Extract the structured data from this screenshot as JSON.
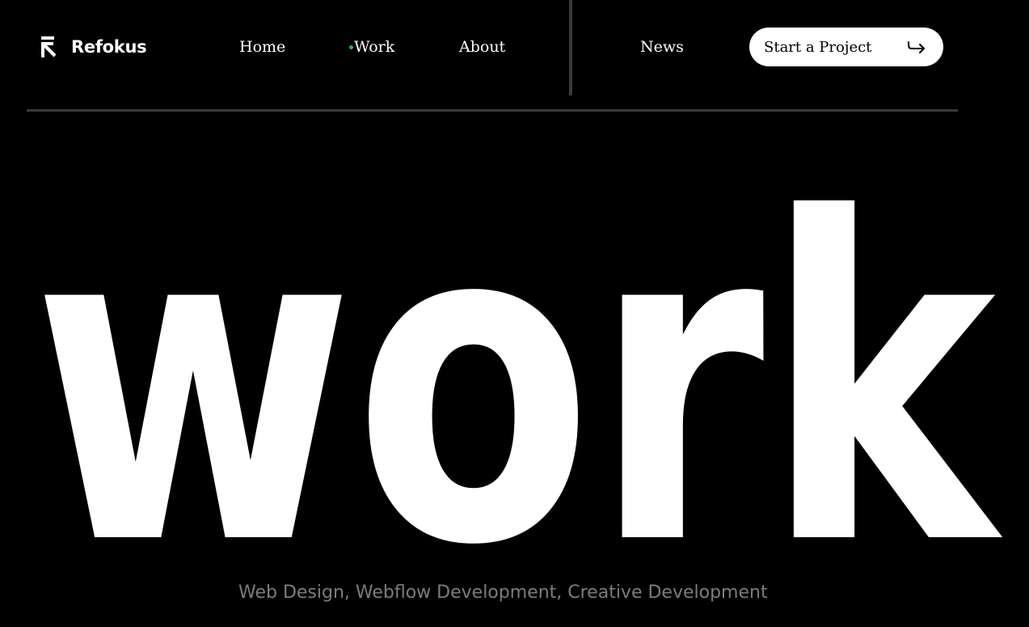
{
  "header": {
    "logo": {
      "name": "Refokus",
      "icon": "refokus-arrow-icon"
    },
    "nav": [
      {
        "label": "Home",
        "active": false
      },
      {
        "label": "Work",
        "active": true
      },
      {
        "label": "About",
        "active": false
      },
      {
        "label": "News",
        "active": false
      }
    ],
    "active_indicator_color": "#1db954",
    "cta": {
      "label": "Start a Project",
      "icon": "return-arrow-icon"
    }
  },
  "hero": {
    "title": "work",
    "subtitle": "Web Design, Webflow Development, Creative Development"
  },
  "colors": {
    "background": "#000000",
    "text": "#ffffff",
    "subtitle": "#7b7b85",
    "divider": "#3a3a3a"
  }
}
